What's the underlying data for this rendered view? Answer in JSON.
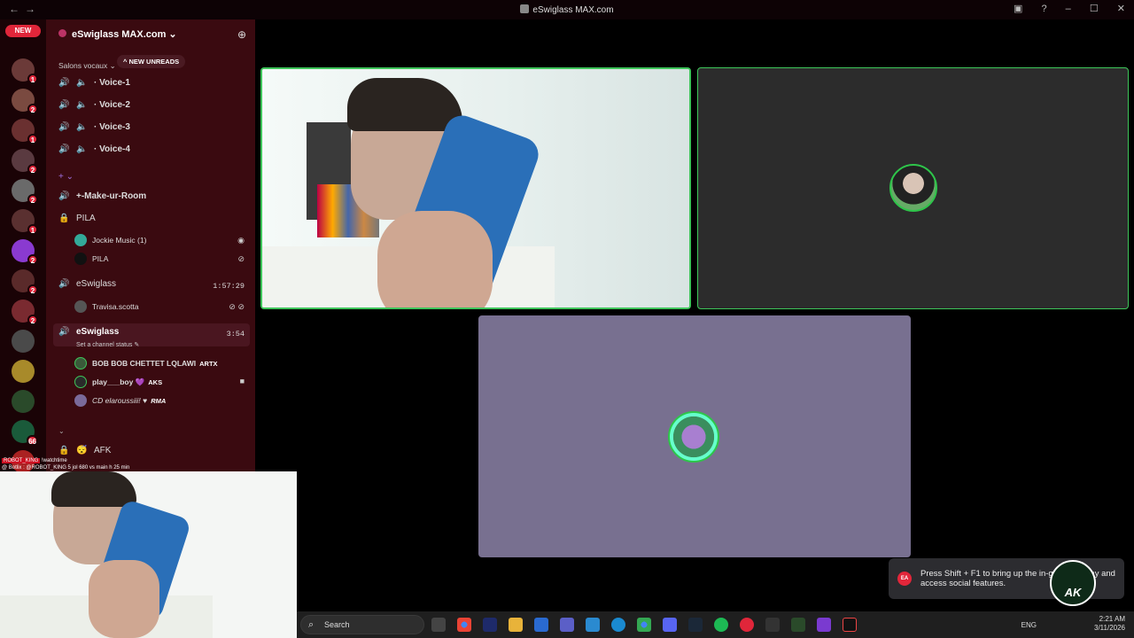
{
  "window": {
    "title": "eSwiglass MAX.com"
  },
  "servers": {
    "new_label": "NEW",
    "badges": [
      "1",
      "2",
      "1",
      "2",
      "2",
      "1",
      "2",
      "2",
      "2",
      "66"
    ]
  },
  "sidebar": {
    "guild_name": "eSwiglass MAX.com",
    "category": "Salons vocaux",
    "new_unreads": "^ NEW UNREADS",
    "channels": [
      {
        "label": "· Voice-1"
      },
      {
        "label": "· Voice-2"
      },
      {
        "label": "· Voice-3"
      },
      {
        "label": "· Voice-4"
      },
      {
        "label": "+-Make-ur-Room"
      },
      {
        "label": "PILA"
      },
      {
        "label": "eSwiglass",
        "timer": "1:57:29"
      },
      {
        "label": "eSwiglass",
        "timer": "3:54",
        "status": "Set a channel status"
      },
      {
        "label": "AFK"
      }
    ],
    "users": [
      {
        "name": "Jockie Music (1)"
      },
      {
        "name": "PILA"
      },
      {
        "name": "Travisa.scotta"
      },
      {
        "name": "BOB BOB CHETTET LQLAWI",
        "tag": "ARTX"
      },
      {
        "name": "play___boy",
        "tag": "AKS"
      },
      {
        "name": "CD elaroussiii!",
        "tag": "RMA"
      }
    ]
  },
  "stream_overlay": {
    "line1_tag": "ROBOT_KING",
    "line1": "!watchtime",
    "line2": "@ Botlix : @ROBOT_KING 5 jol 680 vs main h 25 min"
  },
  "toast": {
    "message": "Press Shift + F1 to bring up the in-game overlay and access social features.",
    "brand": "EA"
  },
  "logo_text": "AK",
  "taskbar": {
    "search_placeholder": "Search",
    "lang": "ENG",
    "time": "2:21 AM",
    "date": "3/11/2026"
  }
}
